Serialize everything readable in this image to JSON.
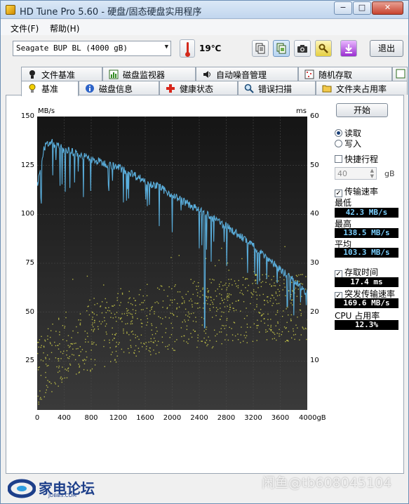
{
  "window": {
    "title": "HD Tune Pro 5.60 - 硬盘/固态硬盘实用程序",
    "min_label": "−",
    "max_label": "□",
    "close_label": "✕"
  },
  "menu": {
    "file": "文件(F)",
    "help": "帮助(H)"
  },
  "toolbar": {
    "drive": "Seagate BUP BL (4000 gB)",
    "temperature": "19℃",
    "exit_label": "退出",
    "icons": [
      "copy-info-icon",
      "copy-screen-icon",
      "camera-icon",
      "options-icon",
      "save-download-icon"
    ]
  },
  "tabs_top": [
    {
      "label": "文件基准",
      "icon": "bulb-icon"
    },
    {
      "label": "磁盘监视器",
      "icon": "bar-chart-icon"
    },
    {
      "label": "自动噪音管理",
      "icon": "speaker-icon"
    },
    {
      "label": "随机存取",
      "icon": "grid-icon"
    }
  ],
  "tabs_bottom": [
    {
      "label": "基准",
      "icon": "bulb-icon",
      "selected": true
    },
    {
      "label": "磁盘信息",
      "icon": "info-icon",
      "selected": false
    },
    {
      "label": "健康状态",
      "icon": "health-cross-icon",
      "selected": false
    },
    {
      "label": "错误扫描",
      "icon": "magnifier-icon",
      "selected": false
    },
    {
      "label": "文件夹占用率",
      "icon": "folder-icon",
      "selected": false
    }
  ],
  "side": {
    "start_label": "开始",
    "read_label": "读取",
    "write_label": "写入",
    "read_selected": true,
    "short_stroke_label": "快捷行程",
    "short_stroke_value": "40",
    "short_stroke_unit": "gB",
    "transfer_rate_label": "传输速率",
    "min_label": "最低",
    "min_value": "42.3 MB/s",
    "max_label": "最高",
    "max_value": "138.5 MB/s",
    "avg_label": "平均",
    "avg_value": "103.3 MB/s",
    "access_time_label": "存取时间",
    "access_time_value": "17.4 ms",
    "burst_rate_label": "突发传输速率",
    "burst_rate_value": "169.6 MB/s",
    "cpu_label": "CPU 占用率",
    "cpu_value": "12.3%"
  },
  "chart_data": {
    "type": "line",
    "y_left_unit": "MB/s",
    "y_right_unit": "ms",
    "x_ticks": [
      "0",
      "400",
      "800",
      "1200",
      "1600",
      "2000",
      "2400",
      "2800",
      "3200",
      "3600",
      "4000gB"
    ],
    "y_left_ticks": [
      "150",
      "125",
      "100",
      "75",
      "50",
      "25"
    ],
    "y_right_ticks": [
      "60",
      "50",
      "40",
      "30",
      "20",
      "10"
    ],
    "xlim": [
      0,
      4000
    ],
    "ylim_left": [
      0,
      150
    ],
    "ylim_right": [
      0,
      60
    ],
    "transfer_rate": {
      "x": [
        0,
        100,
        200,
        400,
        600,
        800,
        1000,
        1200,
        1400,
        1600,
        1800,
        2000,
        2200,
        2400,
        2600,
        2800,
        3000,
        3200,
        3400,
        3600,
        3800,
        4000
      ],
      "y": [
        115,
        134,
        137,
        133,
        131,
        128,
        126,
        124,
        121,
        117,
        114,
        110,
        106,
        102,
        98,
        94,
        89,
        84,
        78,
        72,
        66,
        60
      ],
      "dips": [
        [
          2480,
          42
        ],
        [
          3900,
          55
        ]
      ]
    },
    "access_time_scatter": {
      "description_points": [
        [
          0,
          8
        ],
        [
          400,
          13
        ],
        [
          800,
          15
        ],
        [
          1200,
          17
        ],
        [
          1600,
          18
        ],
        [
          2000,
          19
        ],
        [
          2400,
          20
        ],
        [
          2800,
          20
        ],
        [
          3200,
          21
        ],
        [
          3600,
          21
        ],
        [
          4000,
          21
        ]
      ]
    },
    "colors": {
      "transfer": "#5aaedc",
      "access": "#cfcf4a",
      "background": "#000000",
      "grid": "#4a4a4a"
    }
  },
  "footer": {
    "logo_main": "家电论坛",
    "logo_sub": "JDBBS.COM",
    "watermark": "闲鱼@tb608045104"
  }
}
